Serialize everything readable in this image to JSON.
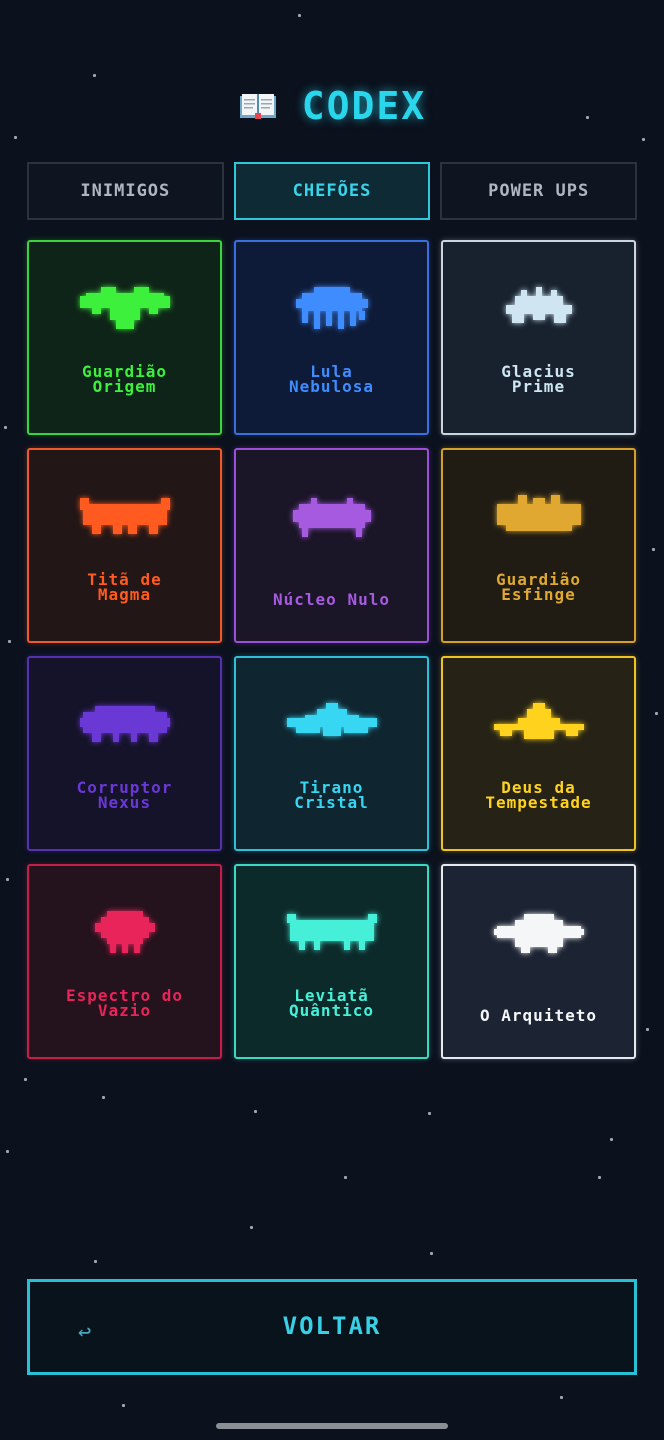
{
  "header": {
    "title": "CODEX",
    "icon": "book-icon"
  },
  "tabs": [
    {
      "label": "INIMIGOS",
      "active": false
    },
    {
      "label": "CHEFÕES",
      "active": true
    },
    {
      "label": "POWER UPS",
      "active": false
    }
  ],
  "bosses": [
    {
      "name_lines": [
        "Guardião",
        "Origem"
      ],
      "color": "#3cf03c",
      "border": "#3bd43b",
      "bg": "#0f2418",
      "sprite": "guardian-origin-sprite"
    },
    {
      "name_lines": [
        "Lula",
        "Nebulosa"
      ],
      "color": "#3f8cff",
      "border": "#3a6fe0",
      "bg": "#0e1b38",
      "sprite": "nebula-squid-sprite"
    },
    {
      "name_lines": [
        "Glacius",
        "Prime"
      ],
      "color": "#cfe6f2",
      "border": "#c9d6e0",
      "bg": "#18222f",
      "sprite": "glacius-prime-sprite"
    },
    {
      "name_lines": [
        "Titã de",
        "Magma"
      ],
      "color": "#ff5a1f",
      "border": "#f05a2a",
      "bg": "#221616",
      "sprite": "magma-titan-sprite"
    },
    {
      "name_lines": [
        "Núcleo Nulo"
      ],
      "color": "#a65ae0",
      "border": "#9c4fd9",
      "bg": "#1b1528",
      "sprite": "null-core-sprite"
    },
    {
      "name_lines": [
        "Guardião",
        "Esfinge"
      ],
      "color": "#e0a830",
      "border": "#d4a02c",
      "bg": "#201c14",
      "sprite": "sphinx-guardian-sprite"
    },
    {
      "name_lines": [
        "Corruptor",
        "Nexus"
      ],
      "color": "#6a38d4",
      "border": "#5530b0",
      "bg": "#15132a",
      "sprite": "nexus-corruptor-sprite"
    },
    {
      "name_lines": [
        "Tirano",
        "Cristal"
      ],
      "color": "#37d6f2",
      "border": "#30bfd8",
      "bg": "#0f2530",
      "sprite": "crystal-tyrant-sprite"
    },
    {
      "name_lines": [
        "Deus da",
        "Tempestade"
      ],
      "color": "#ffd21e",
      "border": "#f0c420",
      "bg": "#262316",
      "sprite": "storm-god-sprite"
    },
    {
      "name_lines": [
        "Espectro do",
        "Vazio"
      ],
      "color": "#e8245a",
      "border": "#c41f4a",
      "bg": "#24121c",
      "sprite": "void-specter-sprite"
    },
    {
      "name_lines": [
        "Leviatã",
        "Quântico"
      ],
      "color": "#46f0d8",
      "border": "#3ad9c2",
      "bg": "#0d2a2b",
      "sprite": "quantum-leviathan-sprite"
    },
    {
      "name_lines": [
        "O Arquiteto"
      ],
      "color": "#f4f6f8",
      "border": "#e6eaef",
      "bg": "#1c2332",
      "sprite": "architect-sprite"
    }
  ],
  "back_button": {
    "label": "VOLTAR",
    "icon": "return-arrow-icon",
    "glyph": "↩"
  }
}
